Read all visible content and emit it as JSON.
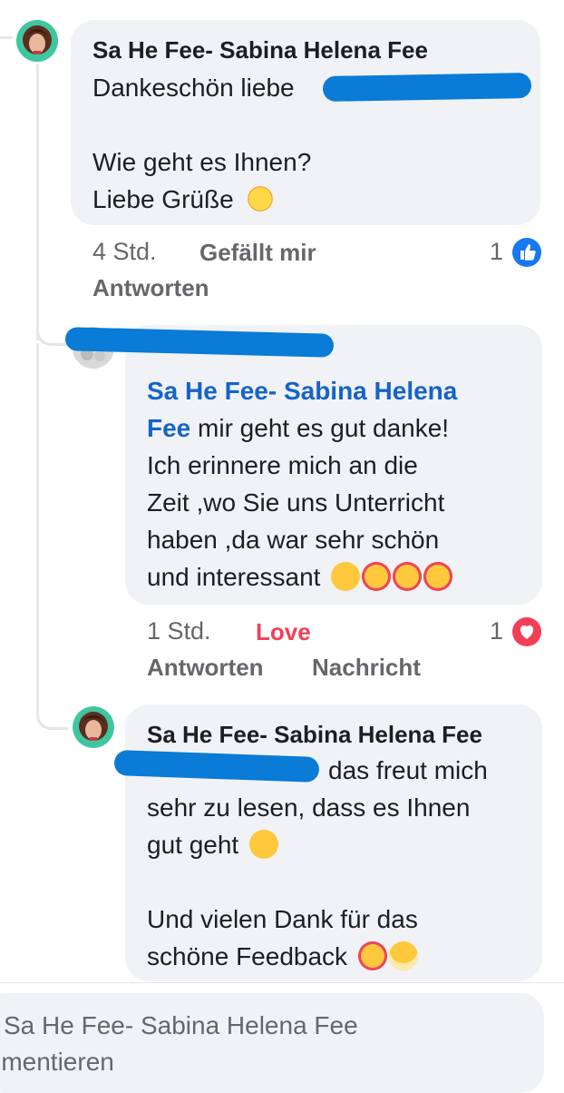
{
  "comment1": {
    "author": "Sa He Fee- Sabina Helena Fee",
    "line1": "Dankeschön liebe",
    "line2": "Wie geht es Ihnen?",
    "line3": "Liebe Grüße",
    "emoji": "sun-emoji",
    "time": "4 Std.",
    "like_label": "Gefällt mir",
    "reply_label": "Antworten",
    "reaction_count": "1",
    "reaction_color": "#1877f2"
  },
  "comment2": {
    "mention": "Sa He Fee- Sabina Helena Fee",
    "mention_a": "Sa He Fee- Sabina Helena",
    "mention_b": "Fee",
    "line1_rest": " mir geht es gut danke!",
    "line2": "Ich erinnere mich an die",
    "line3": "Zeit ,wo Sie uns Unterricht",
    "line4": "haben ,da war sehr schön",
    "line5": "und interessant",
    "emojis": [
      "smiling-face-emoji",
      "smiling-face-hearts-emoji",
      "smiling-face-hearts-emoji",
      "smiling-face-hearts-emoji"
    ],
    "time": "1 Std.",
    "reaction_label": "Love",
    "reaction_label_color": "#f33e58",
    "reply_label": "Antworten",
    "message_label": "Nachricht",
    "reaction_count": "1"
  },
  "comment3": {
    "author": "Sa He Fee- Sabina Helena Fee",
    "line1_rest": "das freut mich",
    "line2": "sehr zu lesen, dass es Ihnen",
    "line3": "gut geht",
    "line4": "Und vielen Dank für das",
    "line5": "schöne Feedback",
    "emojis_line3": [
      "smiling-face-emoji"
    ],
    "emojis_line5": [
      "smiling-face-hearts-emoji",
      "hugging-face-emoji"
    ]
  },
  "composer": {
    "line1": "Sa He Fee- Sabina Helena Fee",
    "line2": "mmentieren"
  }
}
